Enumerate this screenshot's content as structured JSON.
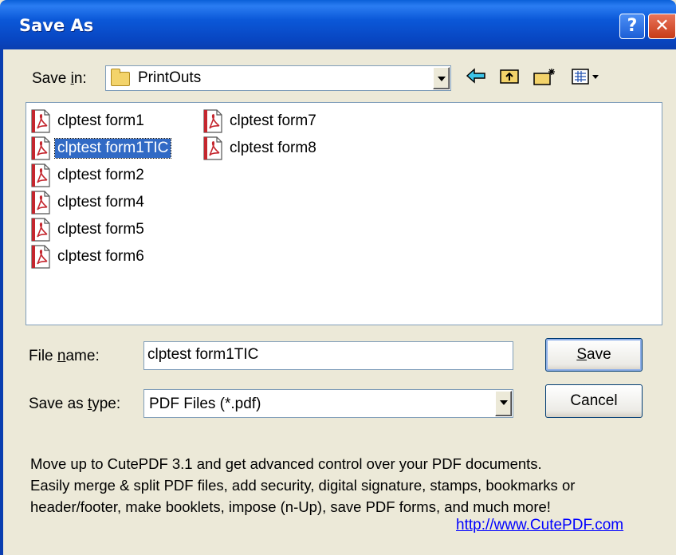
{
  "window": {
    "title": "Save As",
    "help_label": "?",
    "close_label": "✕"
  },
  "save_in": {
    "label": "Save in:",
    "underline_char": "i",
    "value": "PrintOuts"
  },
  "toolbar": {
    "back_icon": "back-arrow-icon",
    "up_icon": "up-folder-icon",
    "new_folder_icon": "new-folder-icon",
    "view_icon": "view-menu-icon"
  },
  "files": [
    {
      "name": "clptest form1",
      "selected": false
    },
    {
      "name": "clptest form1TIC",
      "selected": true
    },
    {
      "name": "clptest form2",
      "selected": false
    },
    {
      "name": "clptest form4",
      "selected": false
    },
    {
      "name": "clptest form5",
      "selected": false
    },
    {
      "name": "clptest form6",
      "selected": false
    },
    {
      "name": "clptest form7",
      "selected": false
    },
    {
      "name": "clptest form8",
      "selected": false
    }
  ],
  "file_name": {
    "label_pre": "File ",
    "label_ul": "n",
    "label_post": "ame:",
    "value": "clptest form1TIC"
  },
  "save_type": {
    "label_pre": "Save as ",
    "label_ul": "t",
    "label_post": "ype:",
    "value": "PDF Files (*.pdf)"
  },
  "buttons": {
    "save_ul": "S",
    "save_rest": "ave",
    "cancel": "Cancel"
  },
  "promo": {
    "line1": "Move up to CutePDF 3.1 and get advanced control over your PDF documents.",
    "line2": "Easily merge & split PDF files, add security, digital signature, stamps, bookmarks or",
    "line3": "header/footer, make booklets, impose (n-Up), save PDF forms, and much more!",
    "link": "http://www.CutePDF.com"
  },
  "colors": {
    "title_bar": "#0a4cc8",
    "selection": "#316ac5",
    "link": "#0000ff",
    "dialog_bg": "#ece9d8"
  }
}
